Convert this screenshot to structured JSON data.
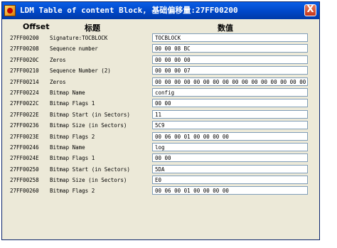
{
  "window": {
    "title": "LDM Table of content Block, 基础偏移量:27FF00200",
    "close_glyph": "X",
    "app_icon": "app-icon",
    "close_icon": "close-icon"
  },
  "columns": {
    "offset": "Offset",
    "title": "标题",
    "value": "数值"
  },
  "rows": [
    {
      "offset": "27FF00200",
      "name": "Signature:TOCBLOCK",
      "value": "TOCBLOCK"
    },
    {
      "offset": "27FF00208",
      "name": "Sequence number",
      "value": "00 00 08 BC"
    },
    {
      "offset": "27FF0020C",
      "name": "Zeros",
      "value": "00 00 00 00"
    },
    {
      "offset": "27FF00210",
      "name": "Sequence Number (2)",
      "value": "00 00 00 07"
    },
    {
      "offset": "27FF00214",
      "name": "Zeros",
      "value": "00 00 00 00 00 00 00 00 00 00 00 00 00 00 00 00"
    },
    {
      "offset": "27FF00224",
      "name": "Bitmap Name",
      "value": "config"
    },
    {
      "offset": "27FF0022C",
      "name": "Bitmap Flags 1",
      "value": "00 00"
    },
    {
      "offset": "27FF0022E",
      "name": "Bitmap Start (in Sectors)",
      "value": "11"
    },
    {
      "offset": "27FF00236",
      "name": "Bitmap Size (in Sectors)",
      "value": "5C9"
    },
    {
      "offset": "27FF0023E",
      "name": "Bitmap Flags 2",
      "value": "00 06 00 01 00 00 00 00"
    },
    {
      "offset": "27FF00246",
      "name": "Bitmap Name",
      "value": "log"
    },
    {
      "offset": "27FF0024E",
      "name": "Bitmap Flags 1",
      "value": "00 00"
    },
    {
      "offset": "27FF00250",
      "name": "Bitmap Start (in Sectors)",
      "value": "5DA"
    },
    {
      "offset": "27FF00258",
      "name": "Bitmap Size (in Sectors)",
      "value": "E0"
    },
    {
      "offset": "27FF00260",
      "name": "Bitmap Flags 2",
      "value": "00 06 00 01 00 00 00 00"
    }
  ]
}
